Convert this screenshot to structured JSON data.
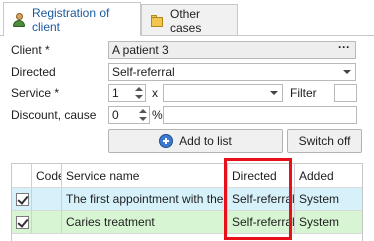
{
  "tabs": [
    {
      "label": "Registration of client",
      "icon": "user-icon",
      "active": true
    },
    {
      "label": "Other cases",
      "icon": "folder-icon",
      "active": false
    }
  ],
  "form": {
    "client_label": "Client *",
    "client_value": "A patient 3",
    "client_browse": "···",
    "directed_label": "Directed",
    "directed_value": "Self-referral",
    "service_label": "Service *",
    "service_qty": "1",
    "service_x": "x",
    "service_value": "",
    "filter_label": "Filter",
    "filter_value": "",
    "discount_label": "Discount, cause",
    "discount_value": "0",
    "discount_pct": "%",
    "cause_value": ""
  },
  "buttons": {
    "add_to_list": "Add to list",
    "switch_off": "Switch off"
  },
  "grid": {
    "columns": [
      "",
      "Code",
      "Service name",
      "Directed",
      "Added"
    ],
    "rows": [
      {
        "checked": true,
        "code": "",
        "service_name": "The first appointment with the ...",
        "directed": "Self-referral",
        "added": "System"
      },
      {
        "checked": true,
        "code": "",
        "service_name": "Caries treatment",
        "directed": "Self-referral",
        "added": "System"
      }
    ]
  },
  "colors": {
    "active_tab_text": "#1a5aa0",
    "row1_bg": "#d7f1fb",
    "row2_bg": "#d7f5d2",
    "highlight": "#e8101b"
  }
}
